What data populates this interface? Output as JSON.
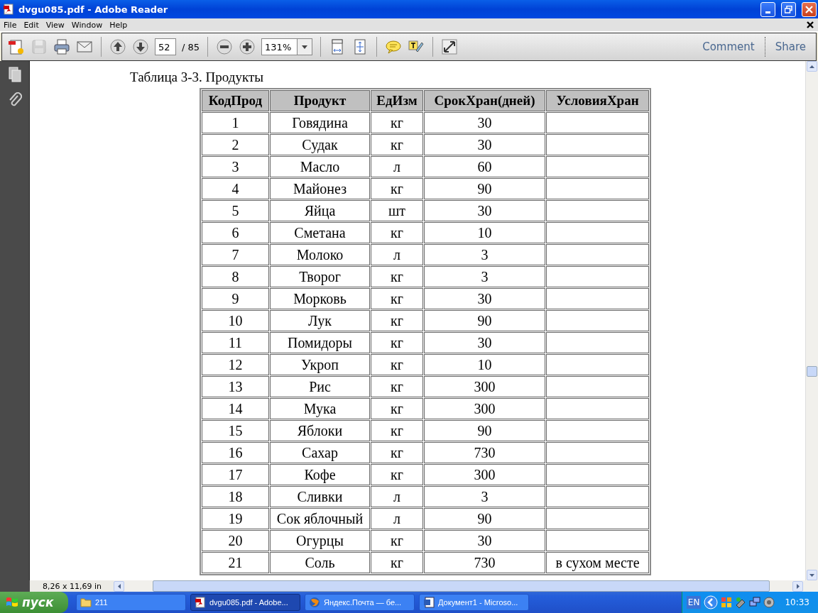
{
  "window": {
    "title": "dvgu085.pdf - Adobe Reader"
  },
  "menu": [
    "File",
    "Edit",
    "View",
    "Window",
    "Help"
  ],
  "toolbar": {
    "tools": [
      {
        "kind": "create",
        "disabled": false
      },
      {
        "kind": "save",
        "disabled": true
      },
      {
        "kind": "print",
        "disabled": false
      },
      {
        "kind": "email",
        "disabled": false
      },
      {
        "kind": "sep"
      },
      {
        "kind": "prev",
        "disabled": false
      },
      {
        "kind": "next",
        "disabled": false
      },
      {
        "kind": "page"
      },
      {
        "kind": "sep"
      },
      {
        "kind": "zoomout",
        "disabled": false
      },
      {
        "kind": "zoomin",
        "disabled": false
      },
      {
        "kind": "zoom"
      },
      {
        "kind": "sep"
      },
      {
        "kind": "fitpage",
        "disabled": false
      },
      {
        "kind": "fitwidth",
        "disabled": false
      },
      {
        "kind": "sep"
      },
      {
        "kind": "note",
        "disabled": false
      },
      {
        "kind": "highlight",
        "disabled": false
      },
      {
        "kind": "sep"
      },
      {
        "kind": "fullscreen",
        "disabled": false
      }
    ],
    "page_number": "52",
    "page_total": "/ 85",
    "zoom": "131%",
    "links": [
      "Comment",
      "Share"
    ]
  },
  "document": {
    "caption": "Таблица 3-3. Продукты",
    "columns": [
      "КодПрод",
      "Продукт",
      "ЕдИзм",
      "СрокХран(дней)",
      "УсловияХран"
    ],
    "rows": [
      [
        "1",
        "Говядина",
        "кг",
        "30"
      ],
      [
        "2",
        "Судак",
        "кг",
        "30"
      ],
      [
        "3",
        "Масло",
        "л",
        "60"
      ],
      [
        "4",
        "Майонез",
        "кг",
        "90"
      ],
      [
        "5",
        "Яйца",
        "шт",
        "30"
      ],
      [
        "6",
        "Сметана",
        "кг",
        "10"
      ],
      [
        "7",
        "Молоко",
        "л",
        "3"
      ],
      [
        "8",
        "Творог",
        "кг",
        "3"
      ],
      [
        "9",
        "Морковь",
        "кг",
        "30"
      ],
      [
        "10",
        "Лук",
        "кг",
        "90"
      ],
      [
        "11",
        "Помидоры",
        "кг",
        "30"
      ],
      [
        "12",
        "Укроп",
        "кг",
        "10"
      ],
      [
        "13",
        "Рис",
        "кг",
        "300"
      ],
      [
        "14",
        "Мука",
        "кг",
        "300"
      ],
      [
        "15",
        "Яблоки",
        "кг",
        "90"
      ],
      [
        "16",
        "Сахар",
        "кг",
        "730"
      ],
      [
        "17",
        "Кофе",
        "кг",
        "300"
      ],
      [
        "18",
        "Сливки",
        "л",
        "3"
      ],
      [
        "19",
        "Сок яблочный",
        "л",
        "90"
      ],
      [
        "20",
        "Огурцы",
        "кг",
        "30"
      ],
      [
        "21",
        "Соль",
        "кг",
        "730",
        "в сухом месте"
      ]
    ]
  },
  "status_bar": {
    "page_size": "8,26 x 11,69 in"
  },
  "taskbar": {
    "start": "пуск",
    "tasks": [
      {
        "kind": "folder",
        "label": "211",
        "selected": false
      },
      {
        "kind": "pdf",
        "label": "dvgu085.pdf - Adobe...",
        "selected": true
      },
      {
        "kind": "browser",
        "label": "Яндекс.Почта — бе...",
        "selected": false
      },
      {
        "kind": "word",
        "label": "Документ1 - Microso...",
        "selected": false
      }
    ],
    "language": "EN",
    "clock": "10:33"
  }
}
